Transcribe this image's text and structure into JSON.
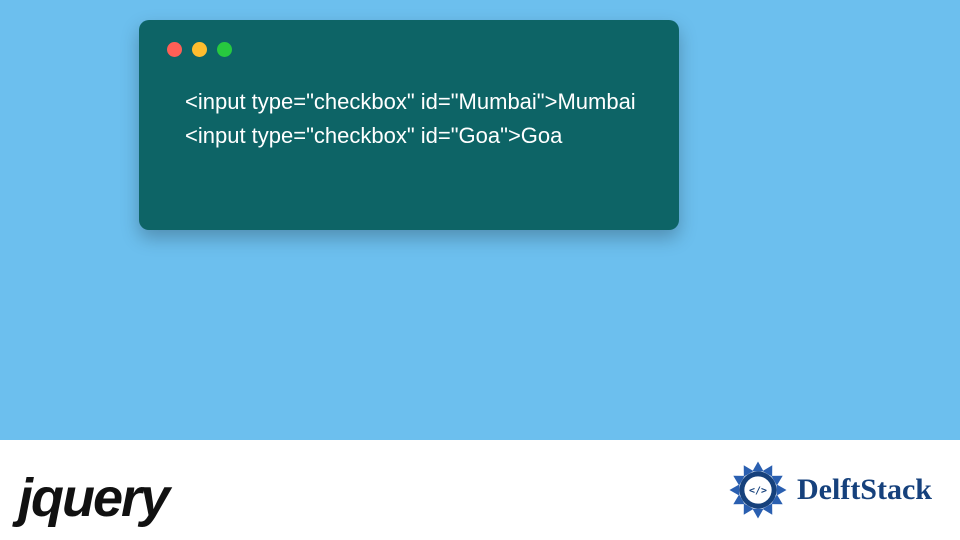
{
  "code": {
    "lines": [
      "<input type=\"checkbox\" id=\"Mumbai\">Mumbai",
      "<input type=\"checkbox\" id=\"Goa\">Goa"
    ]
  },
  "window": {
    "dots": [
      "red",
      "yellow",
      "green"
    ]
  },
  "logos": {
    "jquery": "jQuery",
    "delftstack": "DelftStack"
  },
  "colors": {
    "page_bg": "#6cbfee",
    "card_bg": "#0d6466",
    "code_text": "#ffffff",
    "delft_text": "#16417c",
    "delft_accent": "#2a5fb0",
    "dot_red": "#ff5f56",
    "dot_yellow": "#ffbd2e",
    "dot_green": "#27c93f"
  }
}
